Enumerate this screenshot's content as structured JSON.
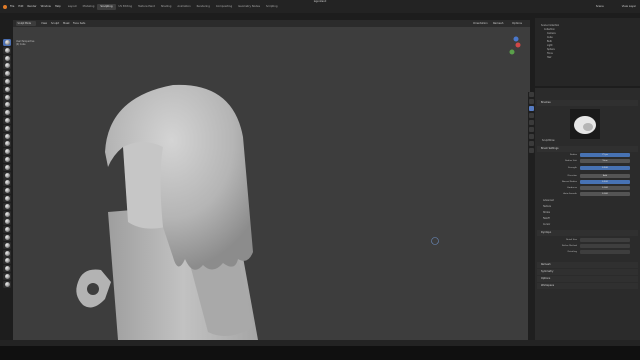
{
  "app": {
    "title": "lego.blend",
    "menus": [
      "File",
      "Edit",
      "Render",
      "Window",
      "Help"
    ],
    "workspaces": [
      "Layout",
      "Modeling",
      "Sculpting",
      "UV Editing",
      "Texture Paint",
      "Shading",
      "Animation",
      "Rendering",
      "Compositing",
      "Geometry Nodes",
      "Scripting"
    ],
    "active_workspace": "Sculpting",
    "scene": "Scene",
    "view_layer": "View Layer"
  },
  "header": {
    "mode": "Sculpt Mode",
    "menus": [
      "View",
      "Sculpt",
      "Mask",
      "Face Sets"
    ],
    "brush_name": "SculptDraw",
    "radius_label": "Radius",
    "radius_value": "71 px",
    "strength_label": "Strength",
    "strength_value": "0.500",
    "brush_menus": [
      "Brush",
      "Texture",
      "Stroke",
      "Falloff",
      "Cursor"
    ],
    "transform_label": "Orientation",
    "remesh_label": "Remesh",
    "options_label": "Options"
  },
  "viewport": {
    "view_title": "User Perspective",
    "object_label": "(0) Cube"
  },
  "outliner": {
    "title": "Scene Collection",
    "items": [
      {
        "label": "Collection"
      },
      {
        "label": "Camera"
      },
      {
        "label": "Cube"
      },
      {
        "label": "Bulb"
      },
      {
        "label": "Light"
      },
      {
        "label": "Sphere"
      },
      {
        "label": "Torus"
      },
      {
        "label": "Hair"
      }
    ]
  },
  "properties": {
    "brush_section": "Brushes",
    "brush_preview_label": "SculptDraw",
    "brush_settings_section": "Brush Settings",
    "fields": [
      {
        "label": "Radius",
        "value": "71 px"
      },
      {
        "label": "Radius Unit",
        "value": "View"
      },
      {
        "label": "Strength",
        "value": "0.500"
      },
      {
        "label": "Direction",
        "value": "Add"
      },
      {
        "label": "Normal Radius",
        "value": "0.500"
      },
      {
        "label": "Hardness",
        "value": "0.000"
      },
      {
        "label": "Auto-Smooth",
        "value": "0.000"
      }
    ],
    "subsections": [
      "Advanced",
      "Texture",
      "Stroke",
      "Falloff",
      "Cursor"
    ],
    "dyntopo_section": "Dyntopo",
    "dyntopo_fields": [
      "Detail Size",
      "Refine Method",
      "Detailing"
    ],
    "bottom_sections": [
      "Remesh",
      "Symmetry",
      "Options",
      "Workspace"
    ]
  },
  "colors": {
    "accent": "#4772b3",
    "viewport_bg": "#3d3d3d",
    "panel_bg": "#2b2b2b",
    "model": "#bdbdbd"
  }
}
